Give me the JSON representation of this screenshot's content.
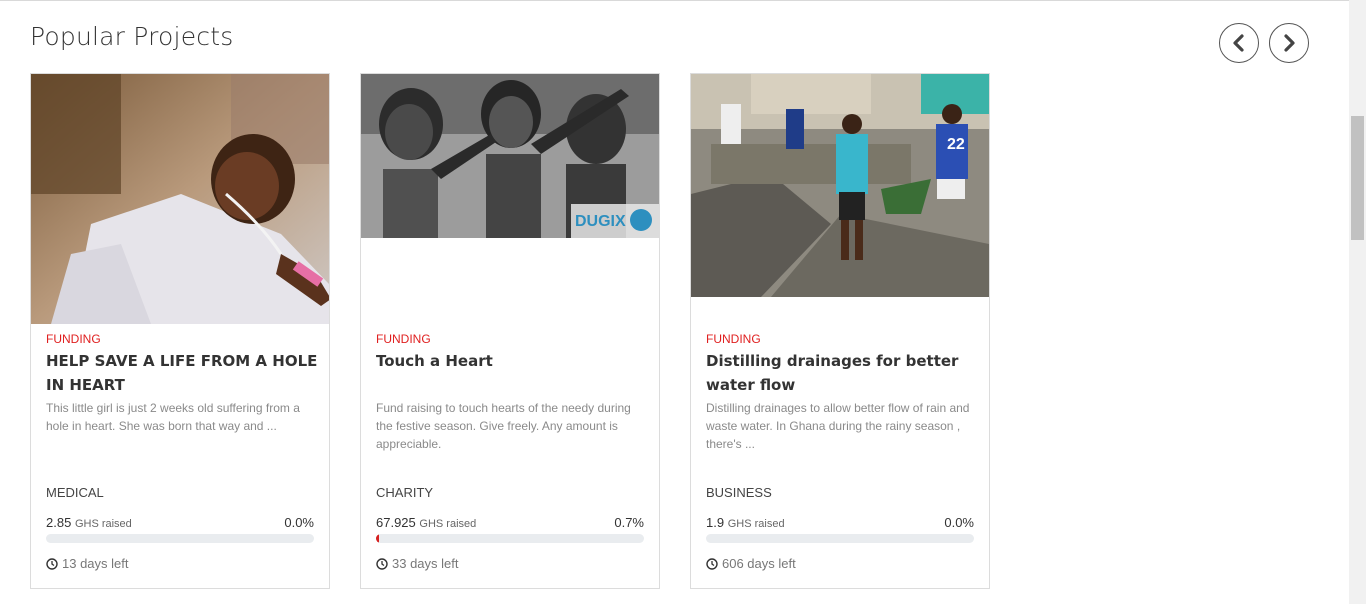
{
  "section": {
    "title": "Popular Projects"
  },
  "nav": {
    "prev_icon": "chevron-left-icon",
    "next_icon": "chevron-right-icon"
  },
  "colors": {
    "accent_red": "#e02020",
    "progress_track": "#e9ecef"
  },
  "projects": [
    {
      "status": "FUNDING",
      "title": "HELP SAVE A LIFE FROM A HOLE IN HEART",
      "description": "This little girl is just 2 weeks old suffering from a hole in heart. She was born that way and ...",
      "category": "MEDICAL",
      "raised_amount": "2.85",
      "raised_label": "GHS raised",
      "percent": "0.0%",
      "progress": 0.0,
      "days_left": "13 days left",
      "image": "photo of an infant in a hospital gown"
    },
    {
      "status": "FUNDING",
      "title": "Touch a Heart",
      "description": "Fund raising to touch hearts of the needy during the festive season. Give freely. Any amount is appreciable.",
      "category": "CHARITY",
      "raised_amount": "67.925",
      "raised_label": "GHS raised",
      "percent": "0.7%",
      "progress": 0.007,
      "days_left": "33 days left",
      "image": "black and white photo of children reaching out",
      "image_badge": "DUGIX"
    },
    {
      "status": "FUNDING",
      "title": "Distilling drainages for better water flow",
      "description": "Distilling drainages to allow better flow of rain and waste water. In Ghana during the rainy season , there's ...",
      "category": "BUSINESS",
      "raised_amount": "1.9",
      "raised_label": "GHS raised",
      "percent": "0.0%",
      "progress": 0.0,
      "days_left": "606 days left",
      "image": "photo of people cleaning a drainage"
    }
  ]
}
